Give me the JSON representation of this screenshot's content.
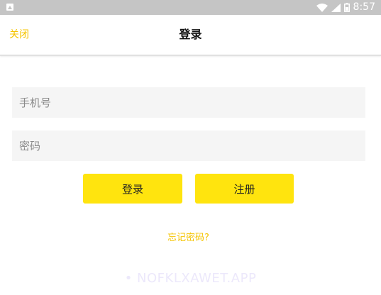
{
  "status_bar": {
    "time": "8:57",
    "icons": [
      "notification-icon",
      "wifi-icon",
      "signal-icon",
      "battery-icon"
    ]
  },
  "header": {
    "close_label": "关闭",
    "title": "登录"
  },
  "form": {
    "phone_placeholder": "手机号",
    "password_placeholder": "密码",
    "login_label": "登录",
    "register_label": "注册",
    "forgot_label": "忘记密码?"
  },
  "watermark": "• NOFKLXAWET.APP",
  "colors": {
    "accent": "#ffe40e",
    "link": "#f5c400",
    "status_bar": "#c5c5c5",
    "field_bg": "#f5f5f5"
  }
}
